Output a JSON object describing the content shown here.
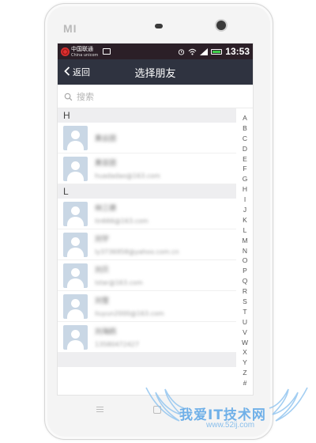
{
  "status_bar": {
    "carrier_name": "中国联通",
    "carrier_sub": "China unicom",
    "time": "13:53",
    "icons": [
      "image-icon",
      "alarm-icon",
      "wifi-icon",
      "signal-icon",
      "battery-icon"
    ],
    "battery_color": "#3fd04b"
  },
  "device": {
    "logo": "MI"
  },
  "nav": {
    "back_label": "返回",
    "title": "选择朋友"
  },
  "search": {
    "placeholder": "搜索"
  },
  "sections": [
    {
      "letter": "H",
      "contacts": [
        {
          "name": "黄云团",
          "detail": ""
        },
        {
          "name": "黄亚团",
          "detail": "huadadao@163.com"
        }
      ]
    },
    {
      "letter": "L",
      "contacts": [
        {
          "name": "林三德",
          "detail": "lin666@163.com"
        },
        {
          "name": "刘宇",
          "detail": "ly3736958@yahoo.com.cn"
        },
        {
          "name": "刘贝",
          "detail": "lstar@163.com"
        },
        {
          "name": "刘莹",
          "detail": "liuyun2000@163.com"
        },
        {
          "name": "刘海鸥",
          "detail": "13580472427"
        }
      ]
    }
  ],
  "index_letters": [
    "A",
    "B",
    "C",
    "D",
    "E",
    "F",
    "G",
    "H",
    "I",
    "J",
    "K",
    "L",
    "M",
    "N",
    "O",
    "P",
    "Q",
    "R",
    "S",
    "T",
    "U",
    "V",
    "W",
    "X",
    "Y",
    "Z",
    "#"
  ],
  "watermark": {
    "title": "我爱IT技术网",
    "url": "www.52ij.com"
  },
  "colors": {
    "nav_bg": "#2f3340",
    "status_bg": "#2b1f27",
    "section_bg": "#eeeef0",
    "avatar_bg": "#c9d7e5"
  }
}
